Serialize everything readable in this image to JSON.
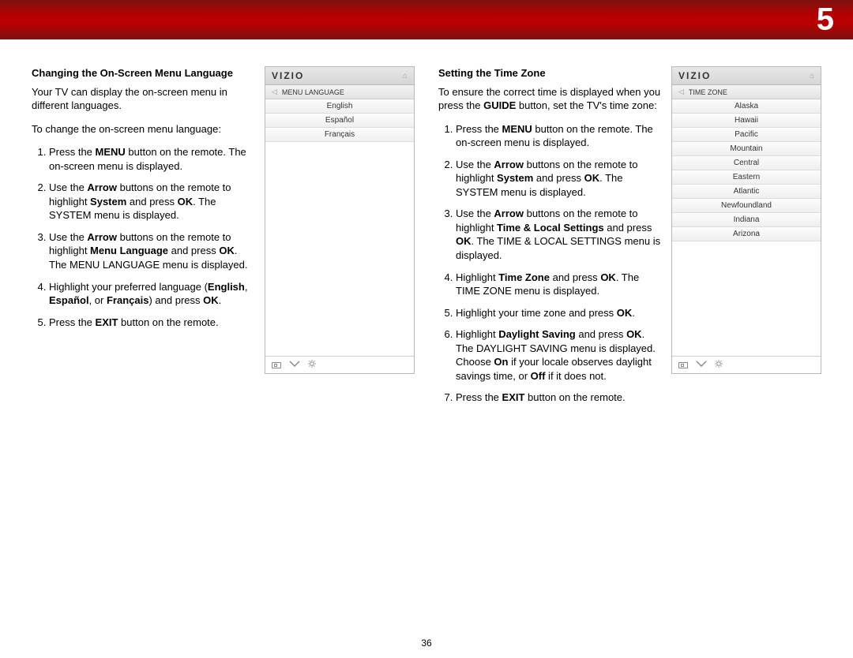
{
  "chapter": "5",
  "page_number": "36",
  "left": {
    "heading": "Changing the On-Screen Menu Language",
    "intro": "Your TV can display the on-screen menu in different languages.",
    "lead": "To change the on-screen menu language:",
    "steps": {
      "s1a": "Press the ",
      "s1b": "MENU",
      "s1c": " button on the remote. The on-screen menu is displayed.",
      "s2a": "Use the ",
      "s2b": "Arrow",
      "s2c": " buttons on the remote to highlight ",
      "s2d": "System",
      "s2e": " and press ",
      "s2f": "OK",
      "s2g": ". The SYSTEM menu is displayed.",
      "s3a": "Use the ",
      "s3b": "Arrow",
      "s3c": " buttons on the remote to highlight ",
      "s3d": "Menu Language",
      "s3e": " and press ",
      "s3f": "OK",
      "s3g": ". The MENU LANGUAGE menu is displayed.",
      "s4a": "Highlight your preferred language (",
      "s4b": "English",
      "s4c": ", ",
      "s4d": "Español",
      "s4e": ", or ",
      "s4f": "Français",
      "s4g": ") and press ",
      "s4h": "OK",
      "s4i": ".",
      "s5a": "Press the ",
      "s5b": "EXIT",
      "s5c": " button on the remote."
    },
    "menu": {
      "brand": "VIZIO",
      "title": "MENU LANGUAGE",
      "items": [
        "English",
        "Español",
        "Français"
      ]
    }
  },
  "right": {
    "heading": "Setting the Time Zone",
    "intro_a": "To ensure the correct time is displayed when you press the ",
    "intro_b": "GUIDE",
    "intro_c": " button, set the TV's time zone:",
    "steps": {
      "s1a": "Press the ",
      "s1b": "MENU",
      "s1c": " button on the remote. The on-screen menu is displayed.",
      "s2a": "Use the ",
      "s2b": "Arrow",
      "s2c": " buttons on the remote to highlight ",
      "s2d": "System",
      "s2e": " and press ",
      "s2f": "OK",
      "s2g": ". The SYSTEM menu is displayed.",
      "s3a": "Use the ",
      "s3b": "Arrow",
      "s3c": " buttons on the remote to highlight ",
      "s3d": "Time & Local Settings",
      "s3e": " and press ",
      "s3f": "OK",
      "s3g": ". The TIME & LOCAL SETTINGS menu is displayed.",
      "s4a": "Highlight ",
      "s4b": "Time Zone",
      "s4c": " and press ",
      "s4d": "OK",
      "s4e": ". The TIME ZONE menu is displayed.",
      "s5a": "Highlight your time zone and press ",
      "s5b": "OK",
      "s5c": ".",
      "s6a": "Highlight ",
      "s6b": "Daylight Saving",
      "s6c": " and press ",
      "s6d": "OK",
      "s6e": ". The DAYLIGHT SAVING menu is displayed. Choose ",
      "s6f": "On",
      "s6g": " if your locale observes daylight savings time, or ",
      "s6h": "Off",
      "s6i": " if it does not.",
      "s7a": "Press the ",
      "s7b": "EXIT",
      "s7c": " button on the remote."
    },
    "menu": {
      "brand": "VIZIO",
      "title": "TIME ZONE",
      "items": [
        "Alaska",
        "Hawaii",
        "Pacific",
        "Mountain",
        "Central",
        "Eastern",
        "Atlantic",
        "Newfoundland",
        "Indiana",
        "Arizona"
      ]
    }
  }
}
